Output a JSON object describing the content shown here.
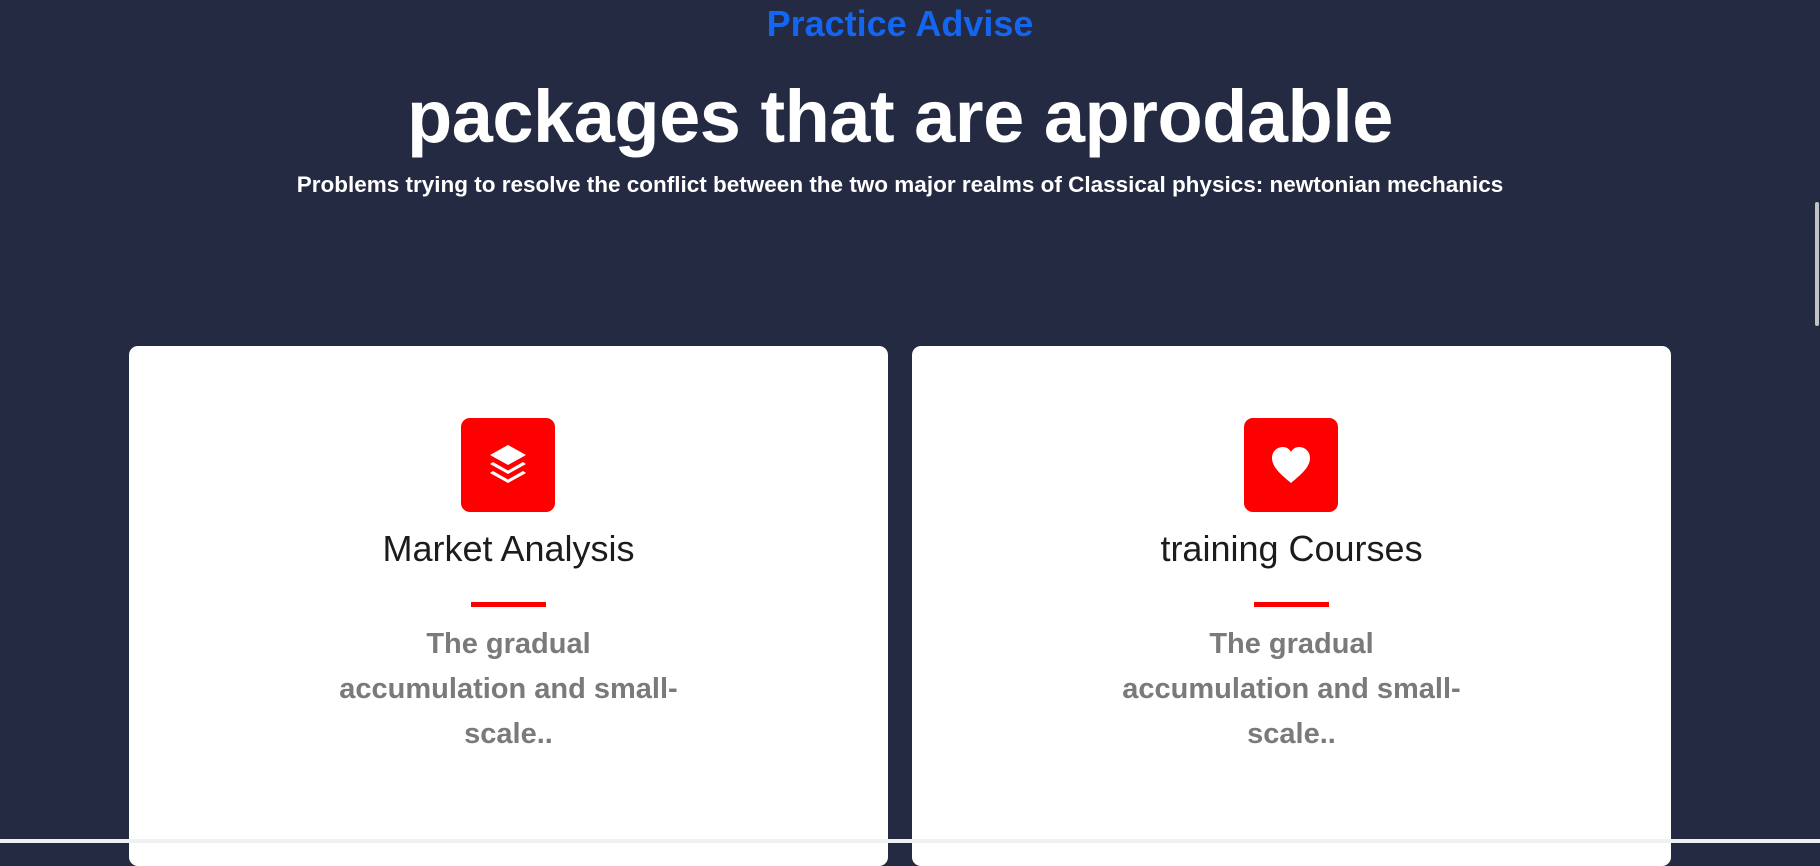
{
  "section": {
    "eyebrow": "Practice Advise",
    "headline": "packages that are aprodable",
    "subhead": "Problems trying to resolve the conflict between the two major realms of Classical physics: newtonian mechanics"
  },
  "cards": [
    {
      "icon": "layers-icon",
      "title": "Market Analysis",
      "description": "The gradual accumulation and small-scale.."
    },
    {
      "icon": "heart-icon",
      "title": "training Courses",
      "description": "The gradual accumulation and small-scale.."
    }
  ],
  "colors": {
    "background": "#252a43",
    "accent": "#ff0000",
    "eyebrow": "#1466f0",
    "card": "#ffffff",
    "card_title": "#1c1c1c",
    "card_desc": "#7a7a7a"
  }
}
